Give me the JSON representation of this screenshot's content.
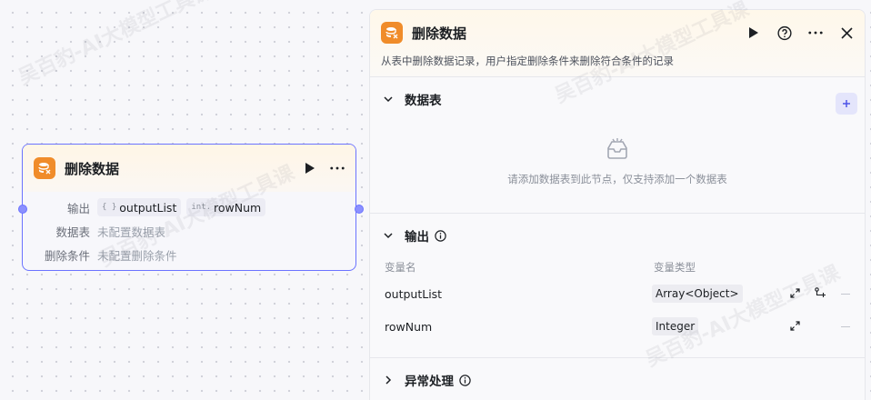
{
  "node": {
    "title": "删除数据",
    "rows": [
      {
        "label": "输出"
      },
      {
        "label": "数据表",
        "value": "未配置数据表"
      },
      {
        "label": "删除条件",
        "value": "未配置删除条件"
      }
    ],
    "outputs": [
      {
        "type": "{ }",
        "name": "outputList"
      },
      {
        "type": "int.",
        "name": "rowNum"
      }
    ]
  },
  "panel": {
    "title": "删除数据",
    "description": "从表中删除数据记录，用户指定删除条件来删除符合条件的记录",
    "table_section": {
      "title": "数据表",
      "empty_text": "请添加数据表到此节点，仅支持添加一个数据表"
    },
    "output_section": {
      "title": "输出",
      "col_name": "变量名",
      "col_type": "变量类型",
      "rows": [
        {
          "name": "outputList",
          "type": "Array<Object>"
        },
        {
          "name": "rowNum",
          "type": "Integer"
        }
      ]
    },
    "error_section": {
      "title": "异常处理"
    }
  },
  "watermark": "吴百豹-AI大模型工具课",
  "colors": {
    "accent": "#6b73ff",
    "icon_orange": "#f08c2a"
  }
}
